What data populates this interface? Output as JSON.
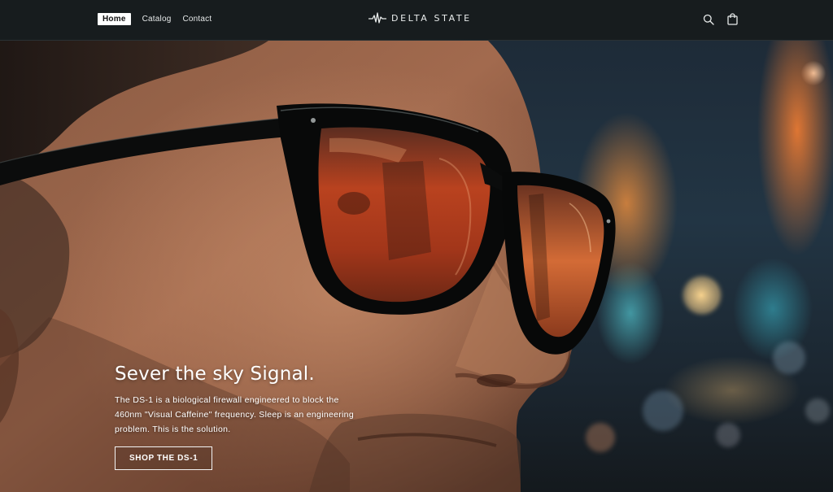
{
  "header": {
    "nav": [
      {
        "label": "Home",
        "active": true
      },
      {
        "label": "Catalog",
        "active": false
      },
      {
        "label": "Contact",
        "active": false
      }
    ],
    "brand": {
      "name": "DELTA STATE",
      "logo_icon": "pulse-waveform-icon"
    },
    "icons": [
      "search-icon",
      "shopping-bag-icon"
    ]
  },
  "hero": {
    "image_icon": "man-wearing-amber-tinted-sunglasses-city-bokeh",
    "title": "Sever the sky Signal.",
    "body": "The DS-1 is a biological firewall engineered to block the 460nm \"Visual Caffeine\" frequency. Sleep is an engineering problem. This is the solution.",
    "cta": "SHOP THE DS-1"
  },
  "colors": {
    "header_bg": "#171c1e",
    "text": "#ffffff",
    "lens_tint": "#c4431f",
    "frame": "#0b0c0c"
  }
}
